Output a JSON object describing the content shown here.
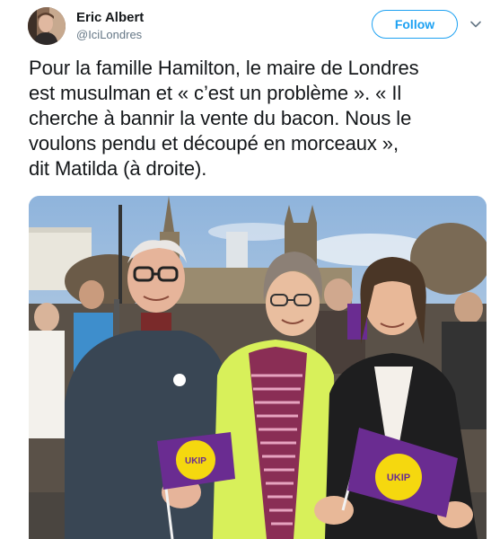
{
  "author": {
    "name": "Eric Albert",
    "handle": "@IciLondres",
    "avatar_icon": "profile-photo"
  },
  "actions": {
    "follow_label": "Follow",
    "menu_icon": "chevron-down-icon"
  },
  "tweet": {
    "lines": [
      "Pour la famille Hamilton, le maire de Londres",
      "est musulman et « c’est un problème ». « Il",
      "cherche à bannir la vente du bacon. Nous le",
      "voulons pendu et découpé en morceaux »,",
      "dit Matilda (à droite)."
    ]
  },
  "photo": {
    "flag_left_text": "UKIP",
    "flag_right_text": "UKIP",
    "colors": {
      "flag_purple": "#6a2c91",
      "flag_yellow": "#f5d80f",
      "vest_yellow": "#c9f23a",
      "sky": "#a9c4e0"
    }
  },
  "colors": {
    "accent": "#1da1f2",
    "text": "#14171a",
    "muted": "#657786"
  }
}
